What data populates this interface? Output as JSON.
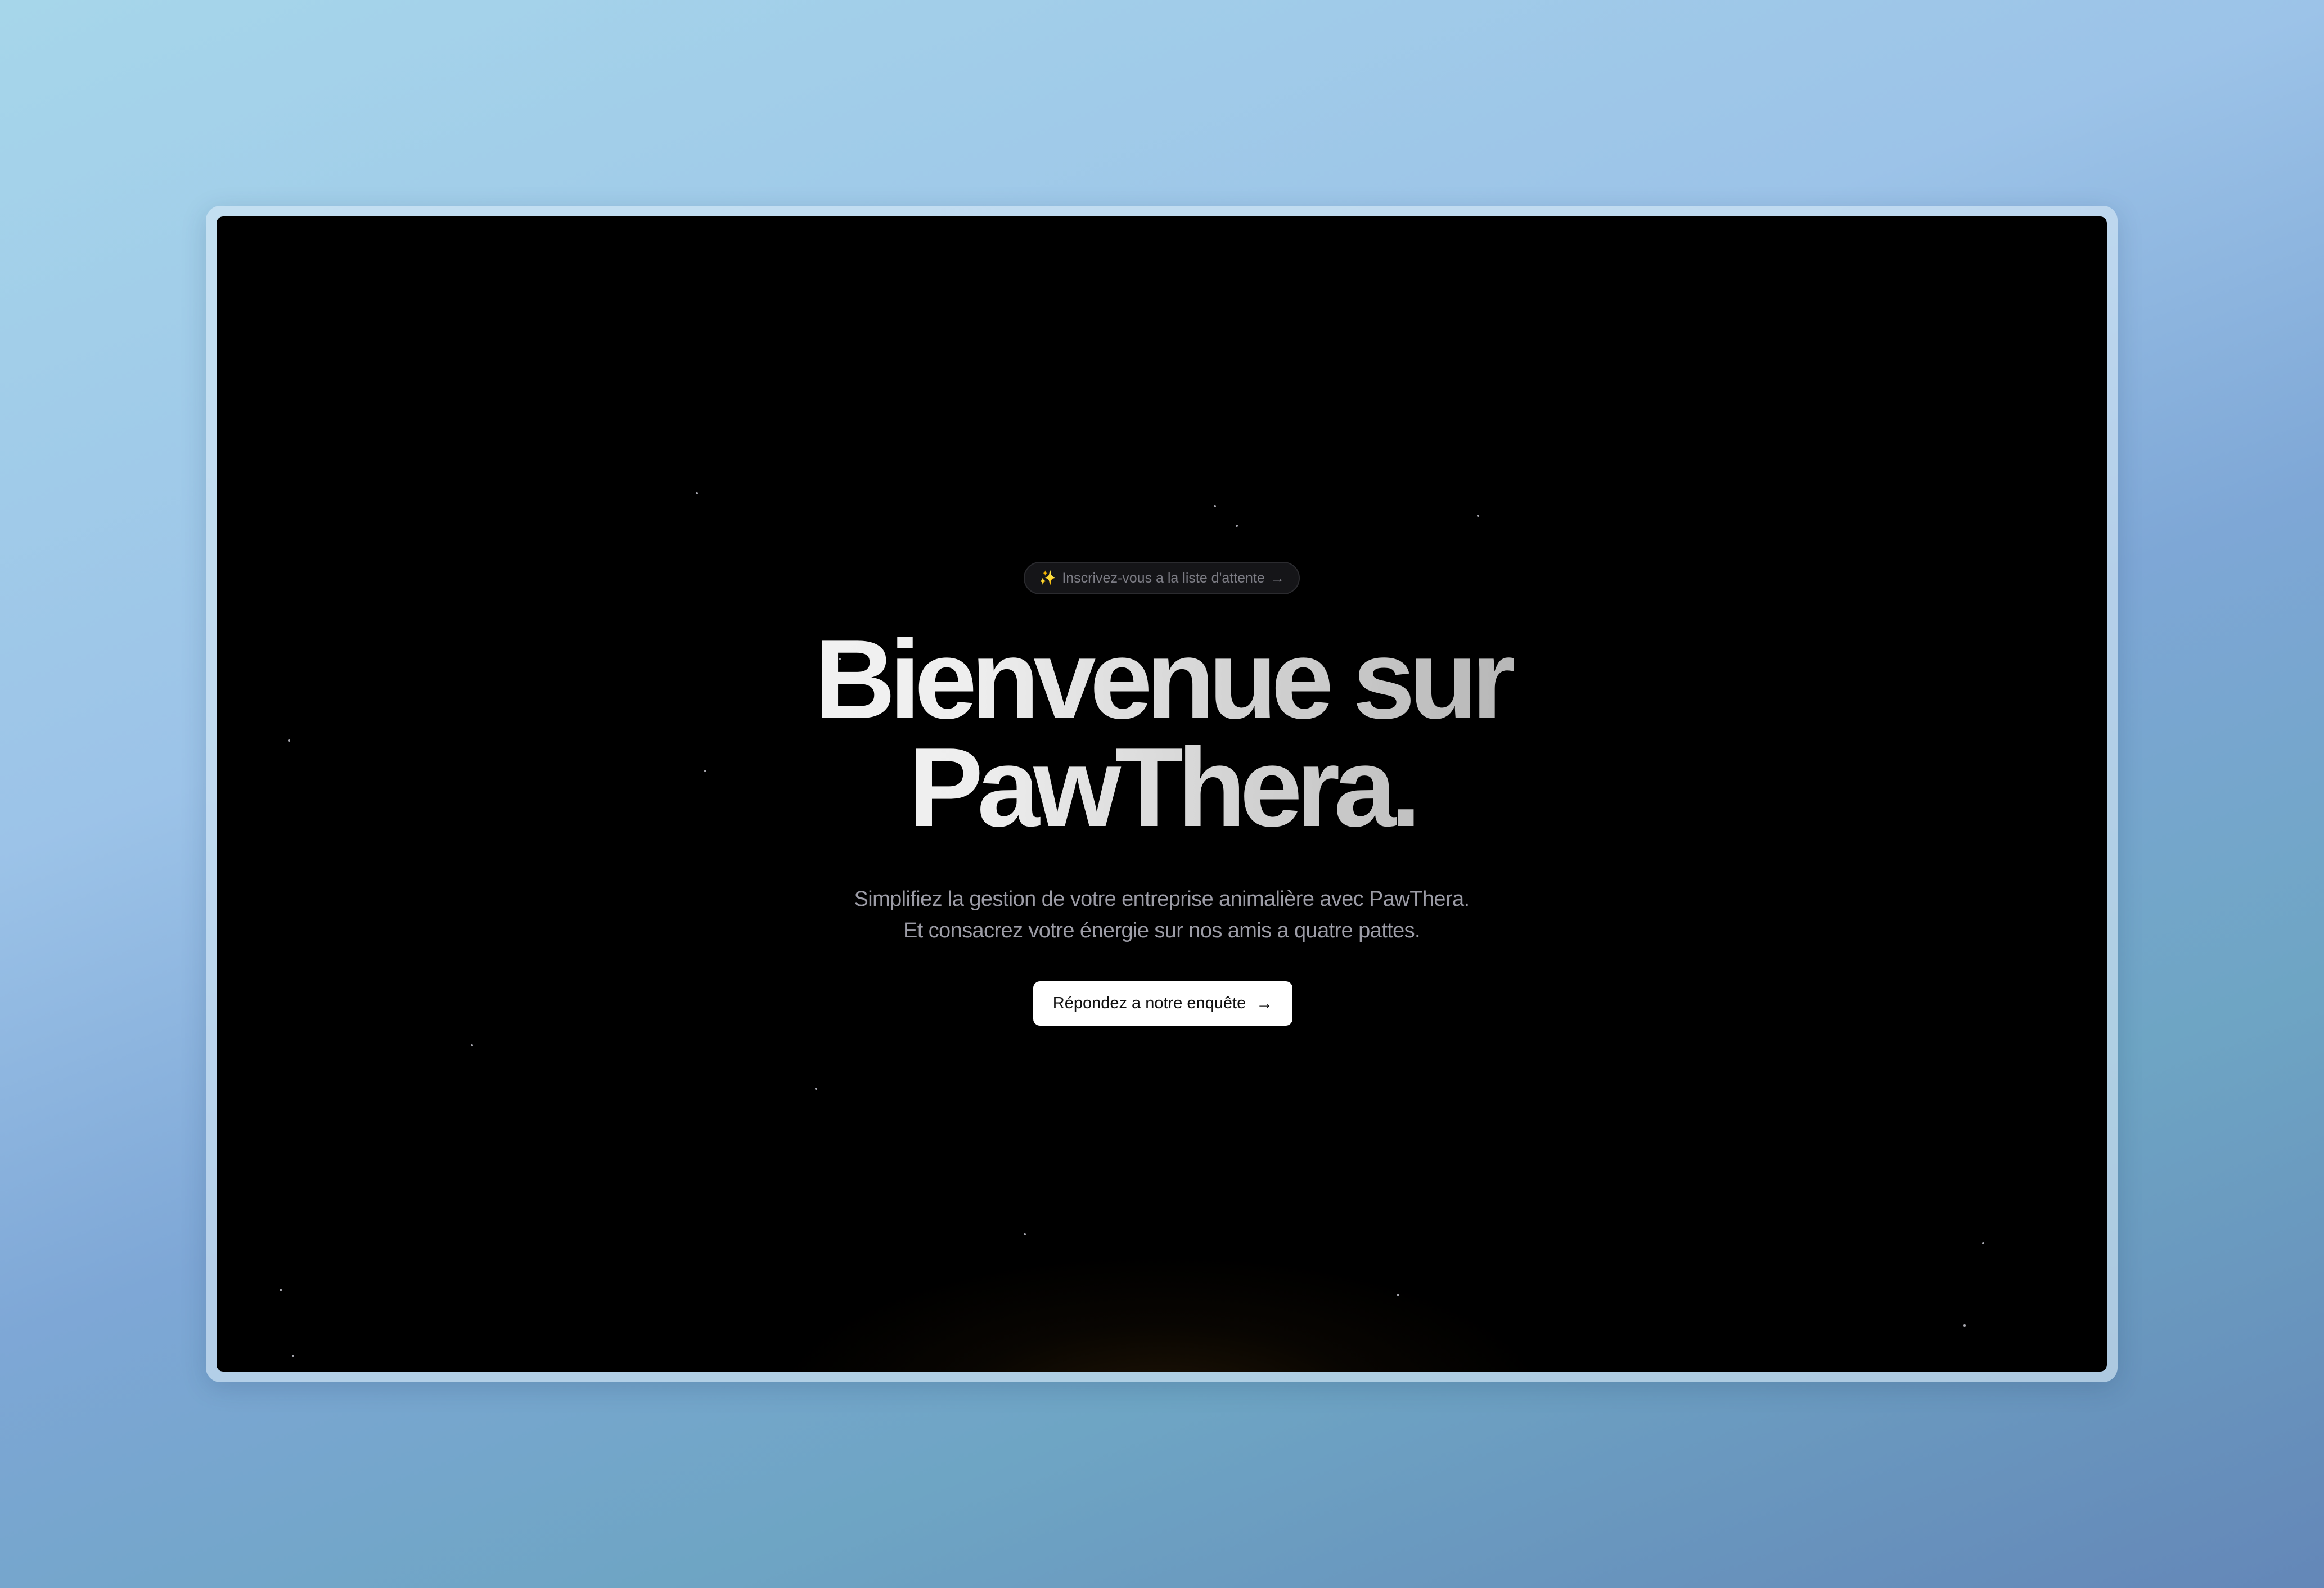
{
  "hero": {
    "waitlist": {
      "icon": "sparkles-icon",
      "sparkle": "✨",
      "label": "Inscrivez-vous a la liste d'attente",
      "arrow": "→"
    },
    "headline": {
      "line1": "Bienvenue sur",
      "line2": "PawThera."
    },
    "subtitle": {
      "line1": "Simplifiez la gestion de votre entreprise animalière avec PawThera.",
      "line2": "Et consacrez votre énergie sur nos amis a quatre pattes."
    },
    "cta": {
      "label": "Répondez a notre enquête",
      "arrow": "→",
      "icon": "arrow-right-icon"
    }
  },
  "colors": {
    "page_background": "#9fc4e6",
    "screen_background": "#000000",
    "headline": "#f0f0f0",
    "subtitle": "#9c9ca6",
    "button_background": "#ffffff",
    "glow": "#634012"
  }
}
